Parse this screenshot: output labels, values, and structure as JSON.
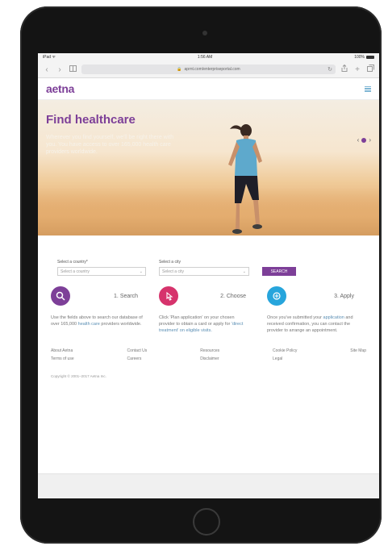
{
  "status_bar": {
    "left": "iPad ᯤ",
    "time": "1:56 AM",
    "battery": "100%"
  },
  "browser": {
    "url": "aprnt.com/enterpriseportal.com",
    "back": "‹",
    "forward": "›",
    "reload": "↻"
  },
  "site": {
    "logo": "aetna"
  },
  "hero": {
    "title": "Find healthcare",
    "text": "Wherever you find yourself, we'll be right there with you. You have access to over 165,000 health care providers worldwide."
  },
  "search": {
    "country_label": "Select a country*",
    "country_value": "Select a country",
    "city_label": "Select a city",
    "city_value": "Select a city",
    "button": "SEARCH"
  },
  "steps": [
    {
      "title": "1. Search",
      "body": "Use the fields above to search our database of over 165,000",
      "link": "health care",
      "body2": "providers worldwide."
    },
    {
      "title": "2. Choose",
      "body": "Click 'Plan application' on your chosen provider to obtain a card or apply for",
      "link": "'direct treatment' on eligible visits.",
      "body2": ""
    },
    {
      "title": "3. Apply",
      "body": "Once you've submitted your",
      "link": "application",
      "body2": "and received confirmation, you can contact the provider to arrange an appointment."
    }
  ],
  "footer": {
    "col1": [
      "About Aetna",
      "Terms of use"
    ],
    "col2": [
      "Contact Us",
      "Careers"
    ],
    "col3": [
      "Resources",
      "Disclaimer"
    ],
    "col4": [
      "Cookie Policy",
      "Legal"
    ],
    "col5": [
      "Site Map"
    ],
    "copyright": "Copyright © 2001–2017 Aetna Inc."
  },
  "colors": {
    "brand": "#7d3f98",
    "step1": "#7d3f98",
    "step2": "#d6336c",
    "step3": "#27a5dc"
  },
  "icons": {
    "step1": "search-icon",
    "step2": "click-icon",
    "step3": "touch-icon",
    "menu": "menu-icon"
  }
}
